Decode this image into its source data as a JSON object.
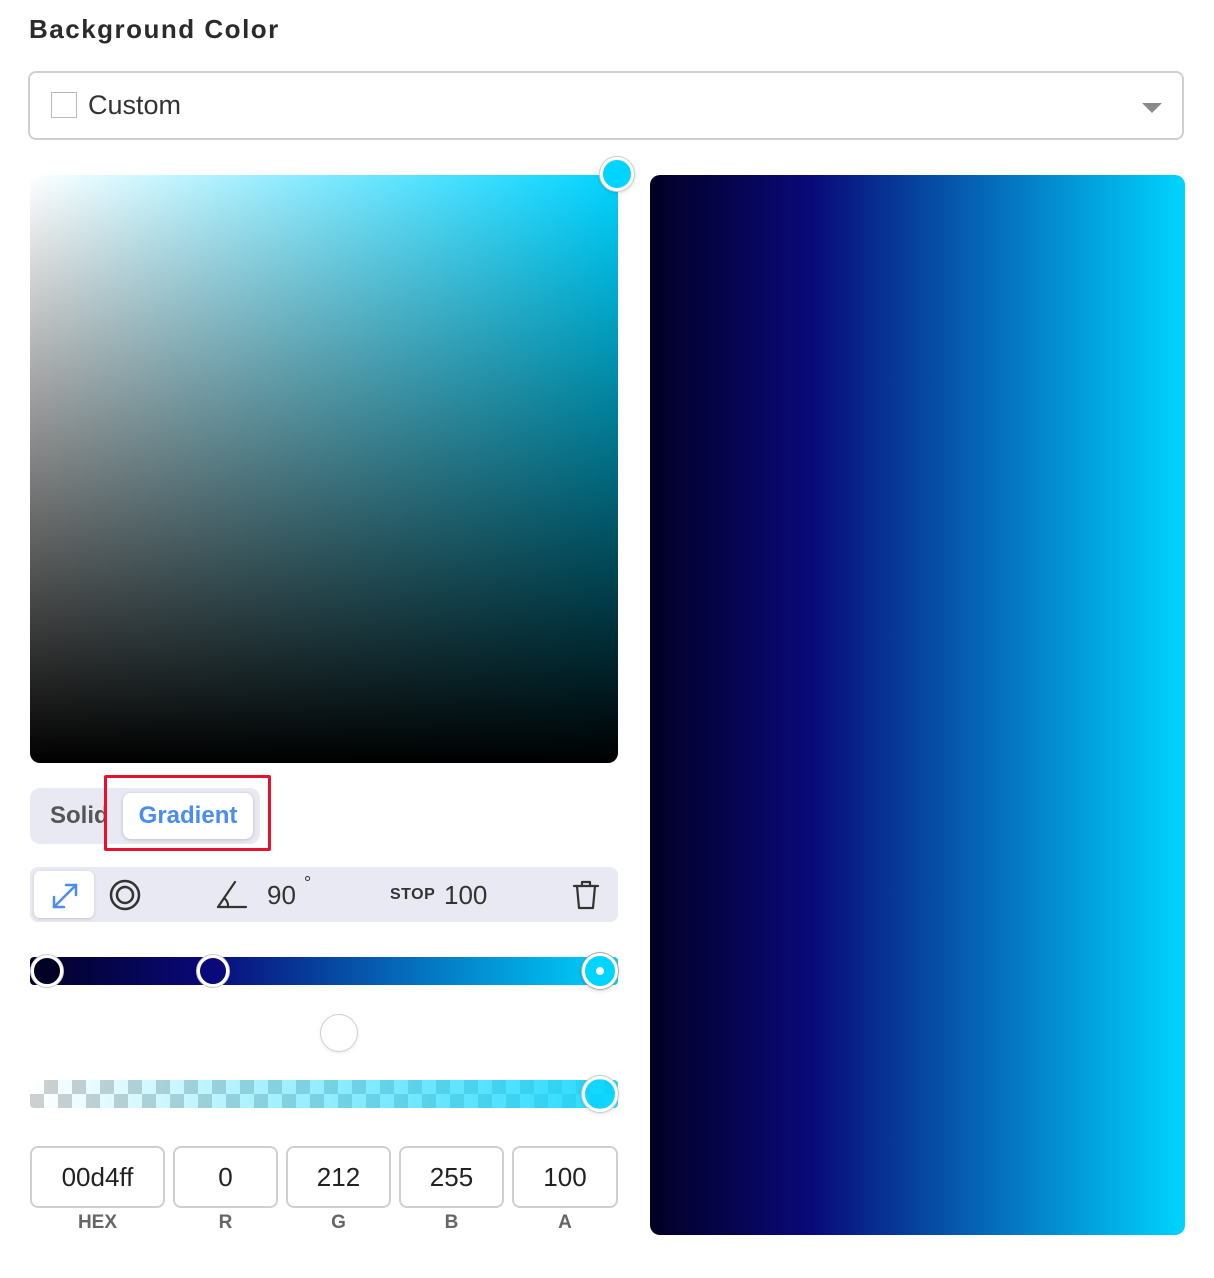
{
  "header": {
    "title": "Background Color"
  },
  "preset_select": {
    "selected": "Custom"
  },
  "picker": {
    "base_hue_color": "#00d4ff"
  },
  "mode": {
    "solid_label": "Solid",
    "gradient_label": "Gradient",
    "active": "Gradient"
  },
  "toolbar": {
    "linear_icon": "diagonal-arrows-icon",
    "radial_icon": "concentric-circles-icon",
    "angle_icon": "angle-icon",
    "angle_value": "90",
    "angle_unit": "°",
    "stop_label": "STOP",
    "stop_value": "100",
    "delete_icon": "trash-icon"
  },
  "gradient": {
    "angle": 90,
    "stops": [
      {
        "color": "#020024",
        "position": 0
      },
      {
        "color": "#090979",
        "position": 30
      },
      {
        "color": "#00d4ff",
        "position": 100,
        "active": true
      }
    ]
  },
  "alpha": {
    "value": 100
  },
  "color_fields": {
    "hex": {
      "value": "00d4ff",
      "label": "HEX"
    },
    "r": {
      "value": "0",
      "label": "R"
    },
    "g": {
      "value": "212",
      "label": "G"
    },
    "b": {
      "value": "255",
      "label": "B"
    },
    "a": {
      "value": "100",
      "label": "A"
    }
  },
  "highlight_color": "#e8112d"
}
